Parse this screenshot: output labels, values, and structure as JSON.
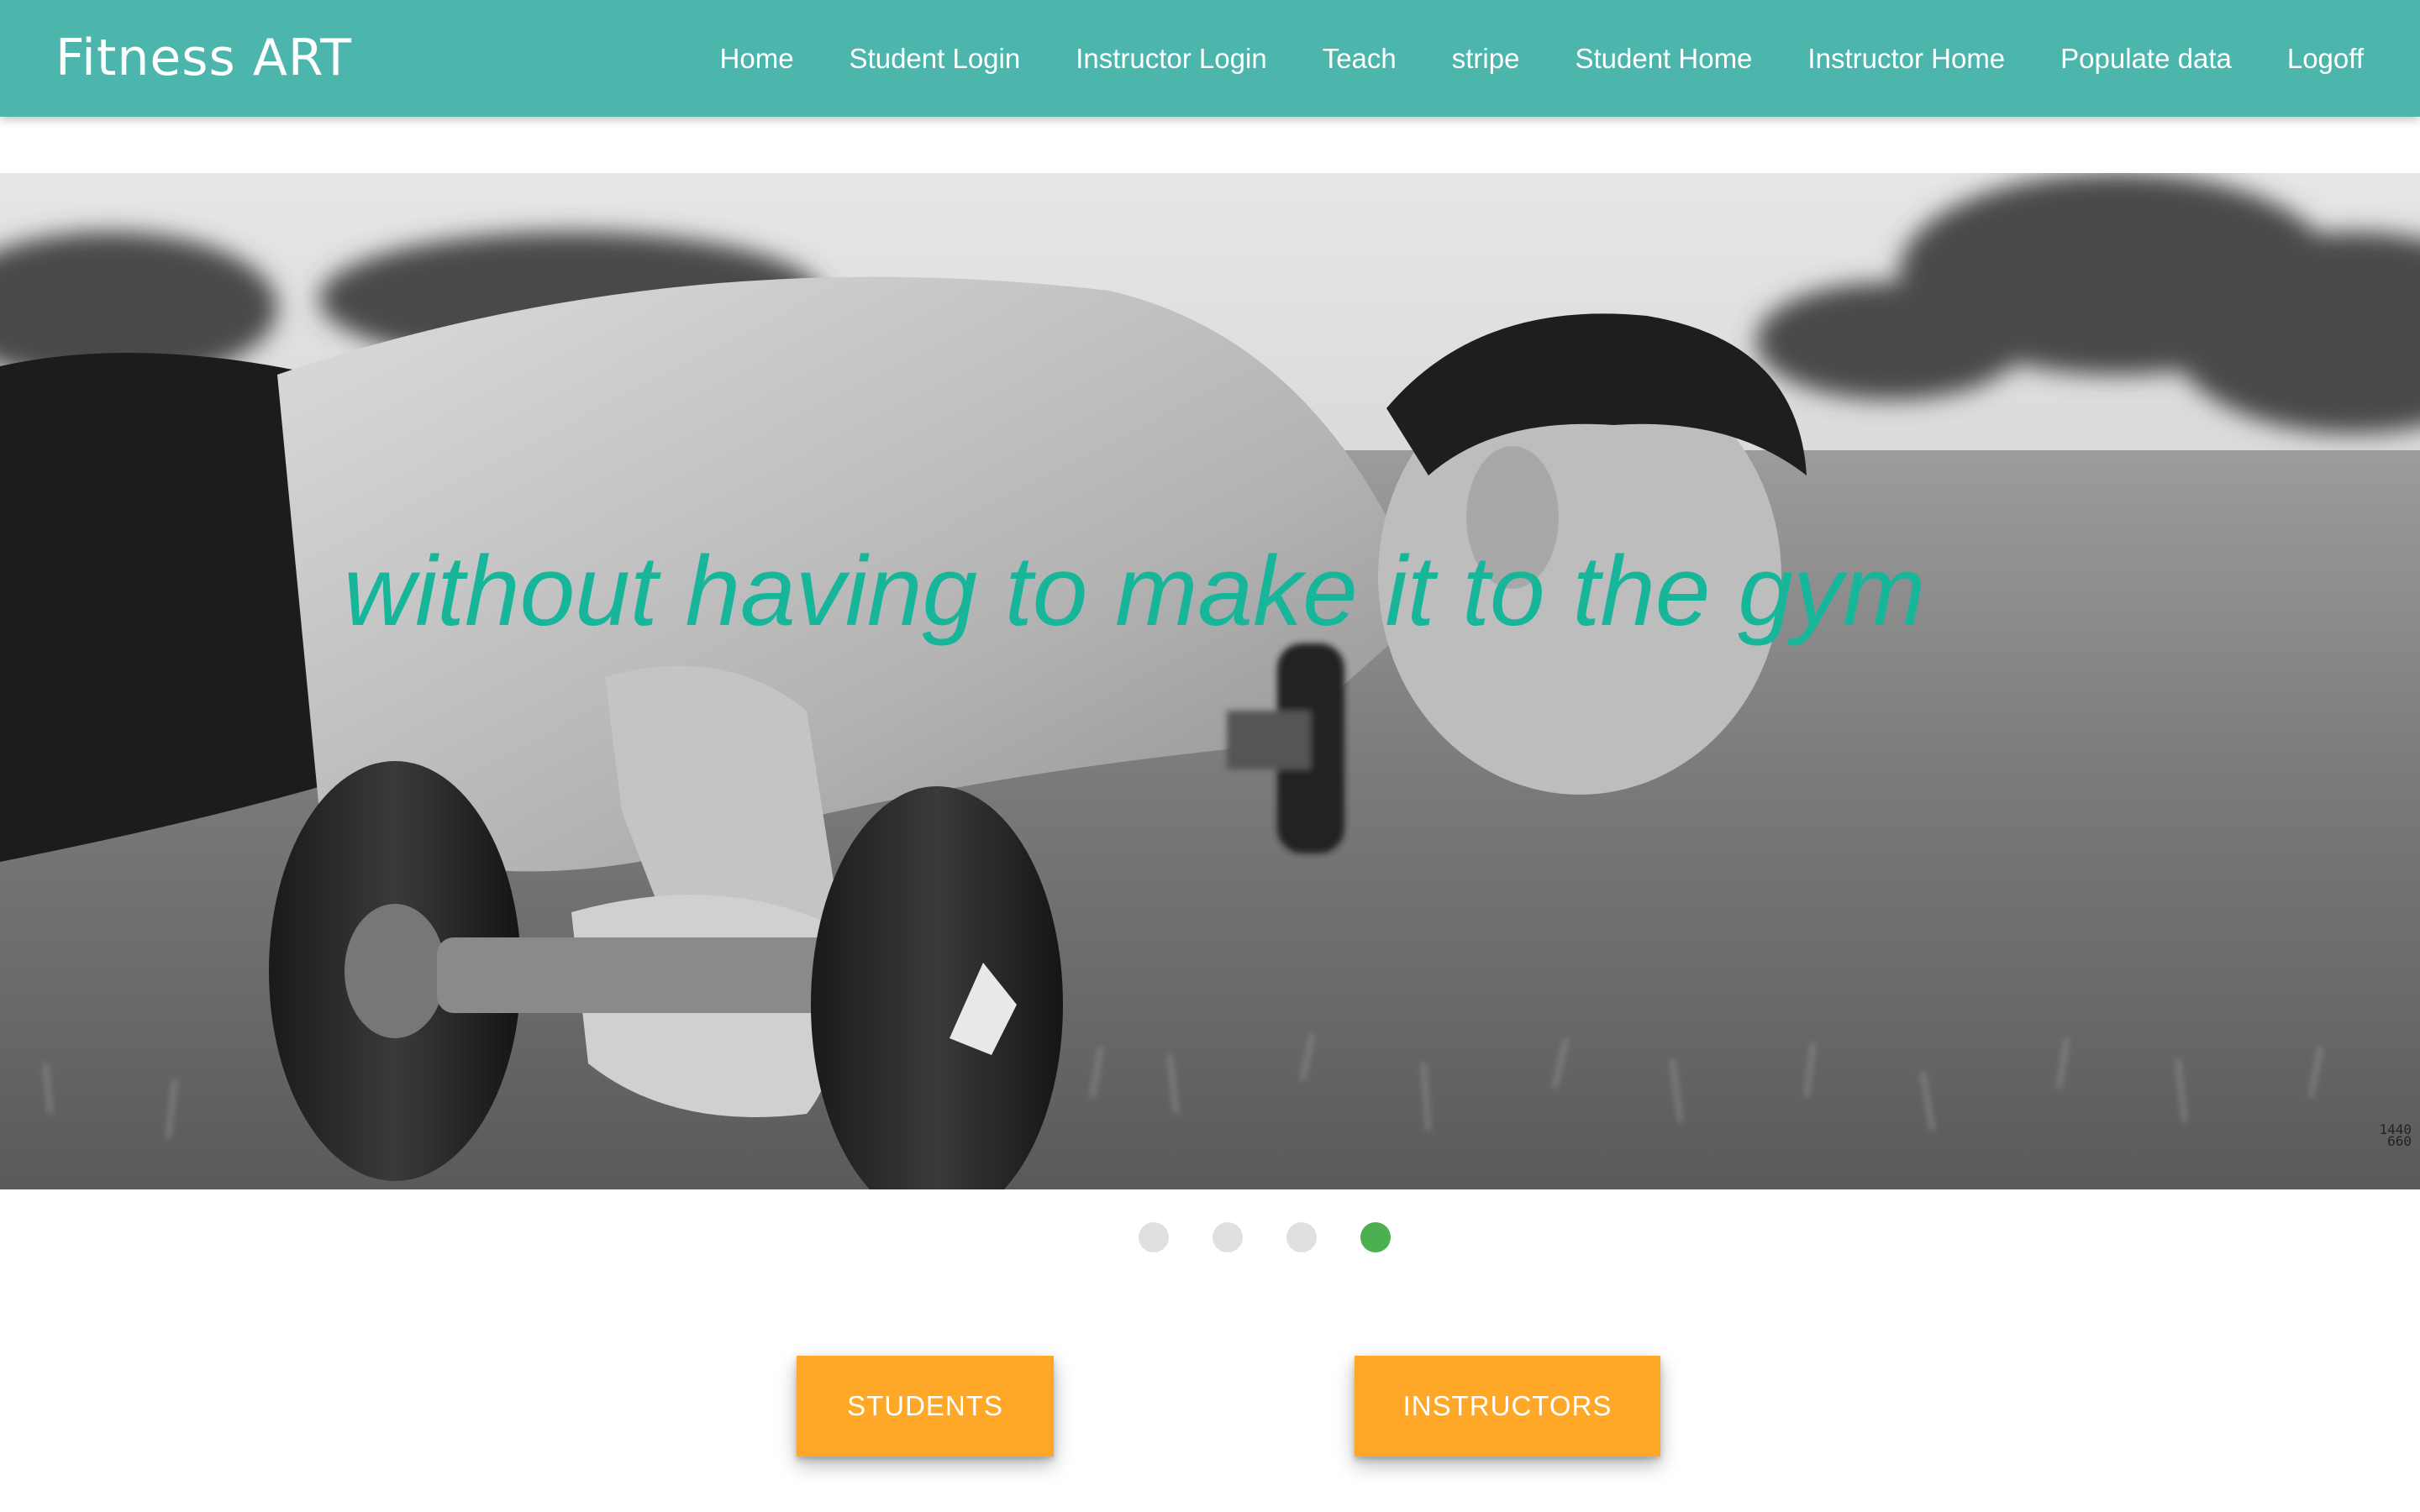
{
  "navbar": {
    "brand": "Fitness ART",
    "links": [
      "Home",
      "Student Login",
      "Instructor Login",
      "Teach",
      "stripe",
      "Student Home",
      "Instructor Home",
      "Populate data",
      "Logoff"
    ]
  },
  "slider": {
    "caption": "without having to make it to the gym",
    "watermark_line1": "1440",
    "watermark_line2": "660",
    "slide_count": 4,
    "active_slide": 4
  },
  "buttons": {
    "students": "STUDENTS",
    "instructors": "INSTRUCTORS"
  },
  "colors": {
    "navbar": "#4db6ac",
    "caption": "#17b69b",
    "button": "#ffa726",
    "indicator_active": "#4caf50",
    "indicator_inactive": "#e0e0e0"
  }
}
